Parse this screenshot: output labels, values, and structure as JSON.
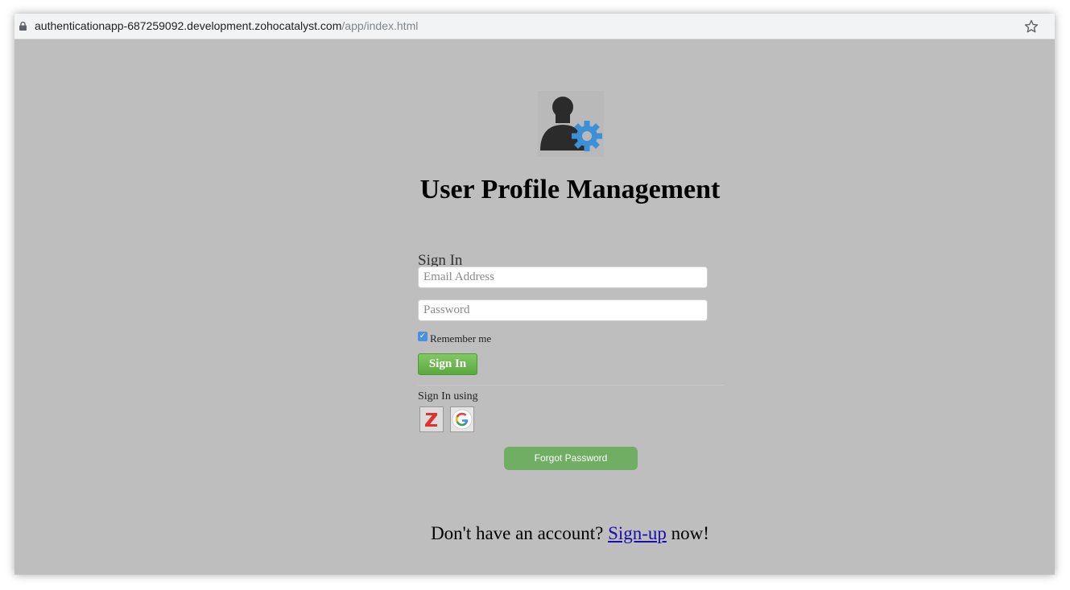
{
  "browser": {
    "url_host": "authenticationapp-687259092.development.zohocatalyst.com",
    "url_path": "/app/index.html"
  },
  "page": {
    "title": "User Profile Management",
    "signin_heading": "Sign In",
    "email_placeholder": "Email Address",
    "password_placeholder": "Password",
    "remember_label": "Remember me",
    "remember_checked": true,
    "signin_button": "Sign In",
    "signin_using_label": "Sign In using",
    "providers": [
      "zoho",
      "google"
    ],
    "forgot_button": "Forgot Password",
    "footer_prefix": "Don't have an account? ",
    "footer_link": "Sign-up",
    "footer_suffix": " now!"
  },
  "colors": {
    "background": "#bebebe",
    "signin_button": "#5ba83f",
    "forgot_button": "#6fae63",
    "gear": "#3d8fd6",
    "link": "#1a0dab"
  }
}
